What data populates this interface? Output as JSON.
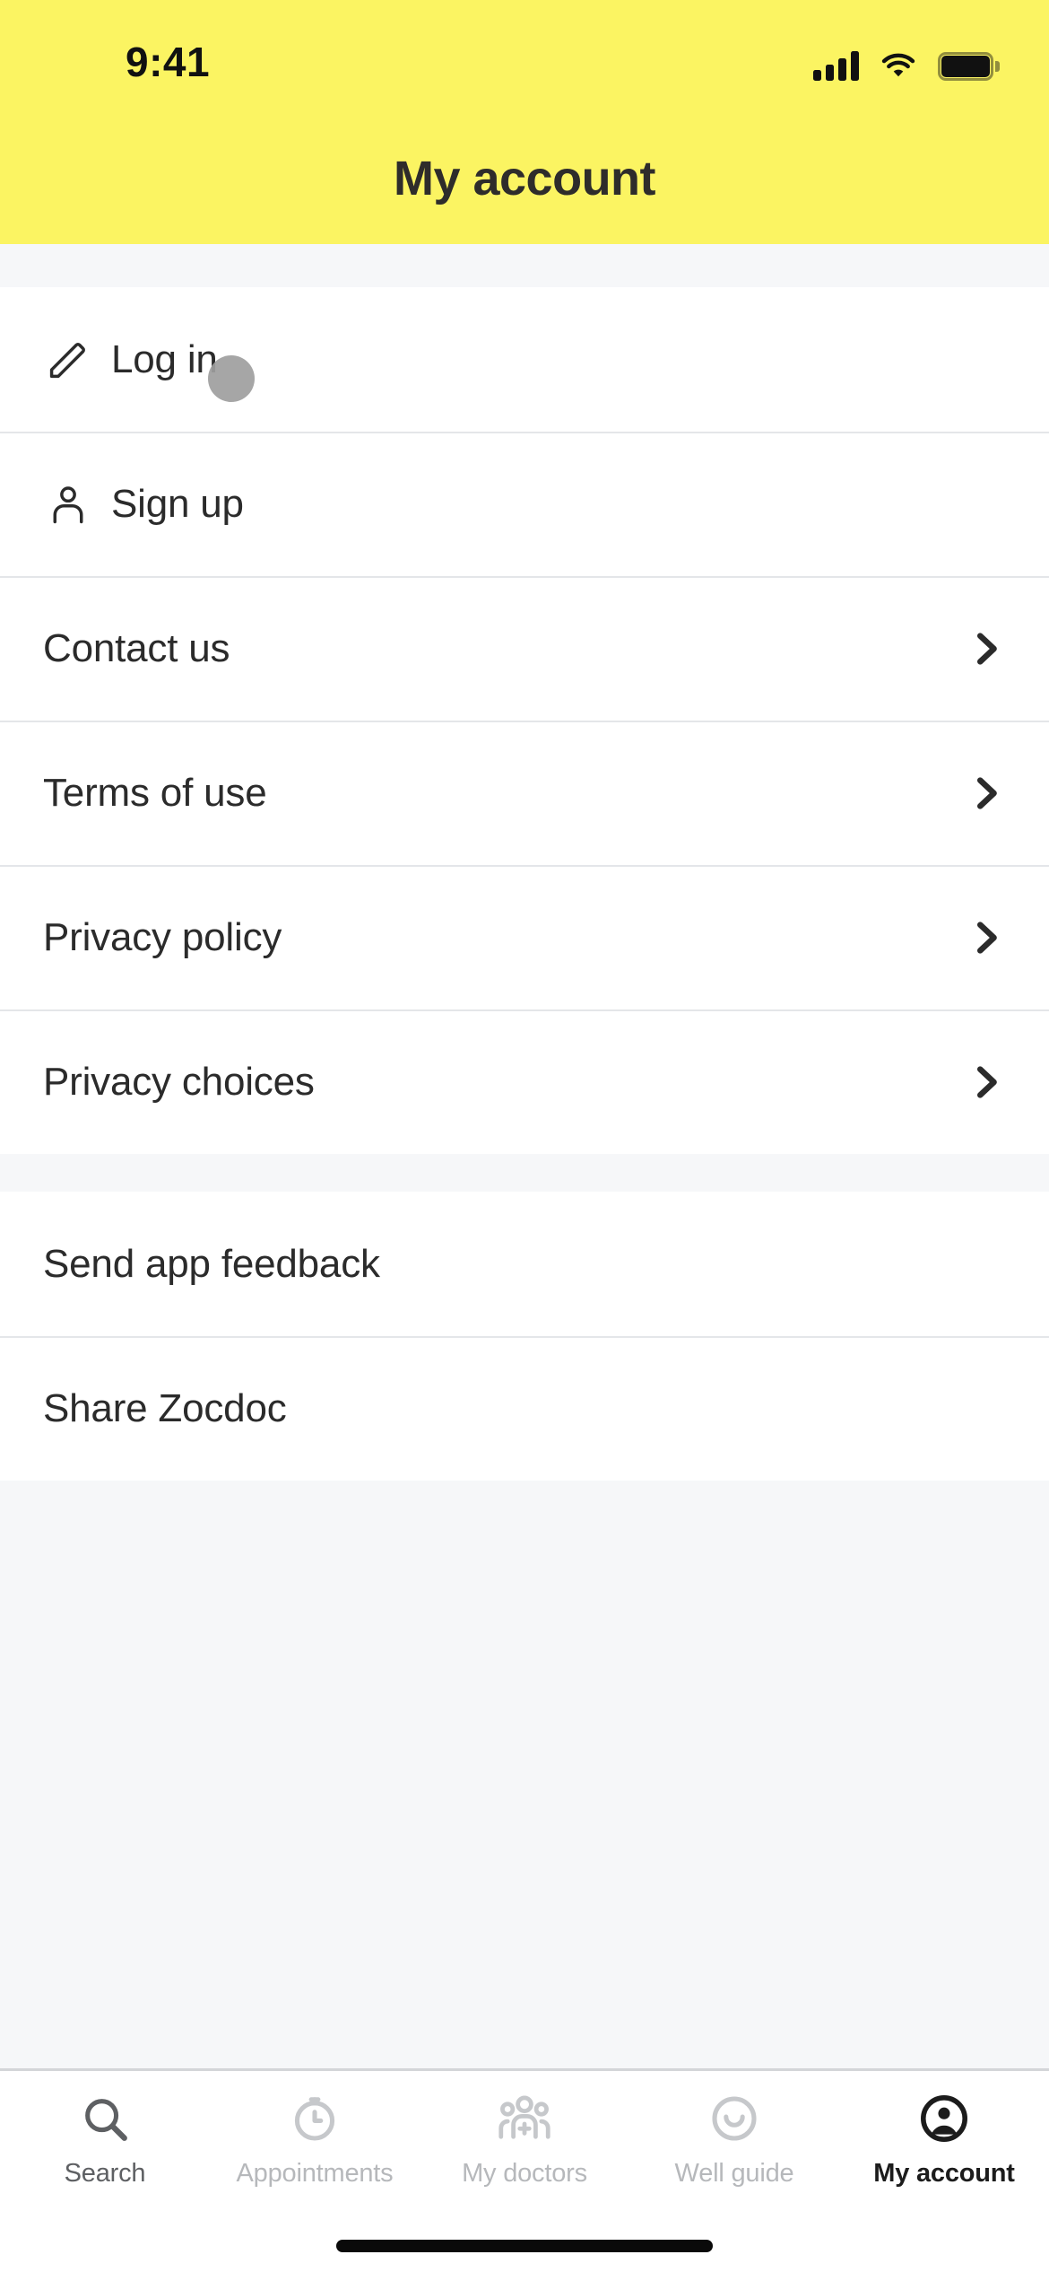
{
  "status_bar": {
    "time": "9:41",
    "signal_icon": "cellular-signal-icon",
    "wifi_icon": "wifi-icon",
    "battery_icon": "battery-full-icon"
  },
  "header": {
    "title": "My account",
    "background_color": "#FBF462",
    "text_color": "#2E2C2B"
  },
  "sections": [
    {
      "id": "account",
      "rows": [
        {
          "label": "Log in",
          "icon": "pencil-icon",
          "chevron": false
        },
        {
          "label": "Sign up",
          "icon": "person-icon",
          "chevron": false
        },
        {
          "label": "Contact us",
          "icon": null,
          "chevron": true
        },
        {
          "label": "Terms of use",
          "icon": null,
          "chevron": true
        },
        {
          "label": "Privacy policy",
          "icon": null,
          "chevron": true
        },
        {
          "label": "Privacy choices",
          "icon": null,
          "chevron": true
        }
      ]
    },
    {
      "id": "app",
      "rows": [
        {
          "label": "Send app feedback",
          "icon": null,
          "chevron": false
        },
        {
          "label": "Share Zocdoc",
          "icon": null,
          "chevron": false
        }
      ]
    }
  ],
  "tab_bar": {
    "items": [
      {
        "label": "Search",
        "icon": "search-icon",
        "active": false,
        "state": "semi"
      },
      {
        "label": "Appointments",
        "icon": "clock-icon",
        "active": false,
        "state": "inactive"
      },
      {
        "label": "My doctors",
        "icon": "doctors-group-icon",
        "active": false,
        "state": "inactive"
      },
      {
        "label": "Well guide",
        "icon": "smile-circle-icon",
        "active": false,
        "state": "inactive"
      },
      {
        "label": "My account",
        "icon": "account-circle-icon",
        "active": true,
        "state": "active"
      }
    ]
  },
  "overlay": {
    "touch_indicator": "touch-indicator-dot",
    "touch_color": "#9E9E9E"
  },
  "colors": {
    "brand_yellow": "#FBF462",
    "page_background": "#F6F7F9",
    "card_background": "#FFFFFF",
    "divider": "#E4E6E9",
    "text_primary": "#2B2B2B",
    "text_muted": "#B6B8BB"
  }
}
